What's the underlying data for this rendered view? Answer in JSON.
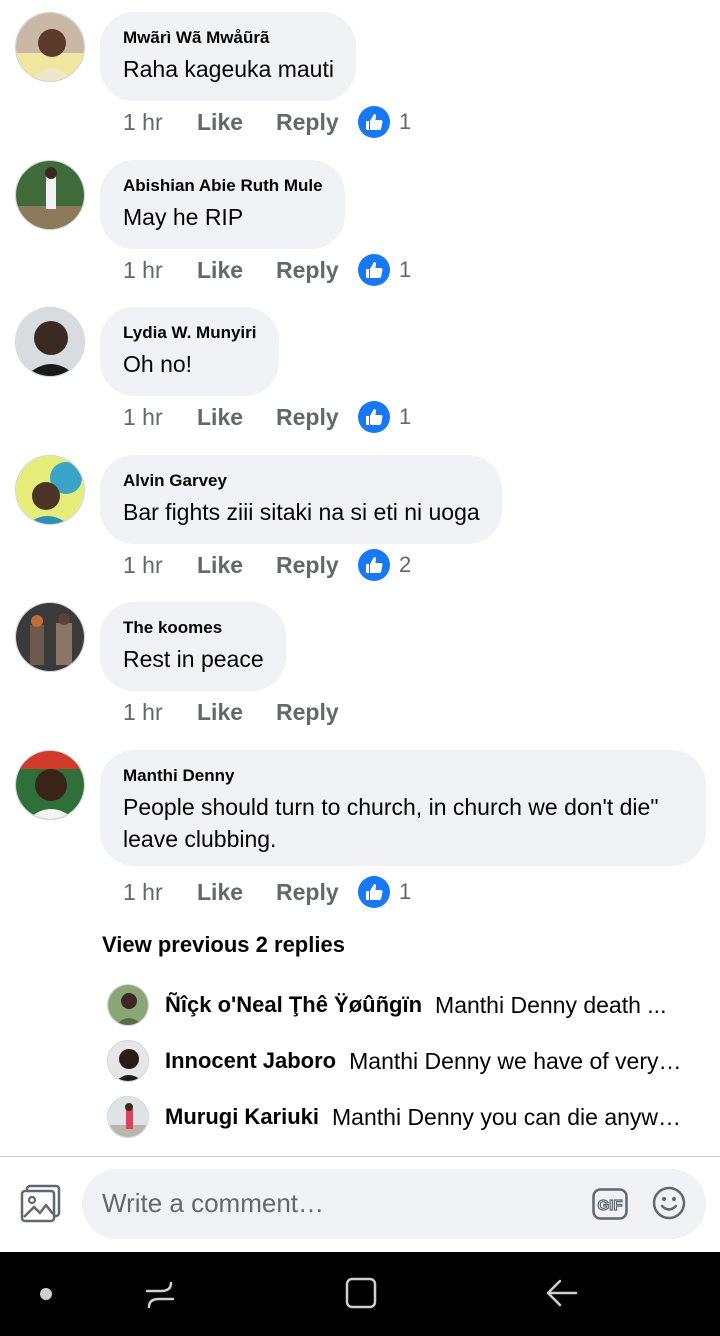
{
  "comments": [
    {
      "author": "Mwãrì Wã Mwåũrã",
      "text": "Raha kageuka mauti",
      "time": "1 hr",
      "like": "Like",
      "reply": "Reply",
      "reactions": "1"
    },
    {
      "author": "Abishian Abie Ruth Mule",
      "text": "May he RIP",
      "time": "1 hr",
      "like": "Like",
      "reply": "Reply",
      "reactions": "1"
    },
    {
      "author": "Lydia W. Munyiri",
      "text": "Oh no!",
      "time": "1 hr",
      "like": "Like",
      "reply": "Reply",
      "reactions": "1"
    },
    {
      "author": "Alvin Garvey",
      "text": "Bar fights ziii sitaki na si eti ni uoga",
      "time": "1 hr",
      "like": "Like",
      "reply": "Reply",
      "reactions": "2"
    },
    {
      "author": "The koomes",
      "text": "Rest in peace",
      "time": "1 hr",
      "like": "Like",
      "reply": "Reply",
      "reactions": ""
    },
    {
      "author": "Manthi Denny",
      "text_line1": "People should turn to church, in church we don't die\"",
      "text_line2": "leave clubbing.",
      "time": "1 hr",
      "like": "Like",
      "reply": "Reply",
      "reactions": "1"
    }
  ],
  "view_previous": "View previous 2 replies",
  "replies": [
    {
      "author": "Ñîçk o'Neal Ţhê Ÿøûñgïn",
      "text": "Manthi Denny death ..."
    },
    {
      "author": "Innocent Jaboro",
      "text": "Manthi Denny we have of very bad habits"
    },
    {
      "author": "Murugi Kariuki",
      "text": "Manthi Denny you can die anywhere"
    }
  ],
  "composer": {
    "placeholder": "Write a comment…",
    "gif_label": "GIF"
  },
  "colors": {
    "bubble": "#f0f2f5",
    "like_blue": "#1877f2",
    "secondary_text": "#65676b",
    "nav_bar": "#000000"
  },
  "icons": [
    "avatar",
    "thumbs-up-icon",
    "photo-icon",
    "gif-icon",
    "emoji-icon",
    "nav-dot-icon",
    "recent-apps-icon",
    "home-icon",
    "back-icon"
  ]
}
